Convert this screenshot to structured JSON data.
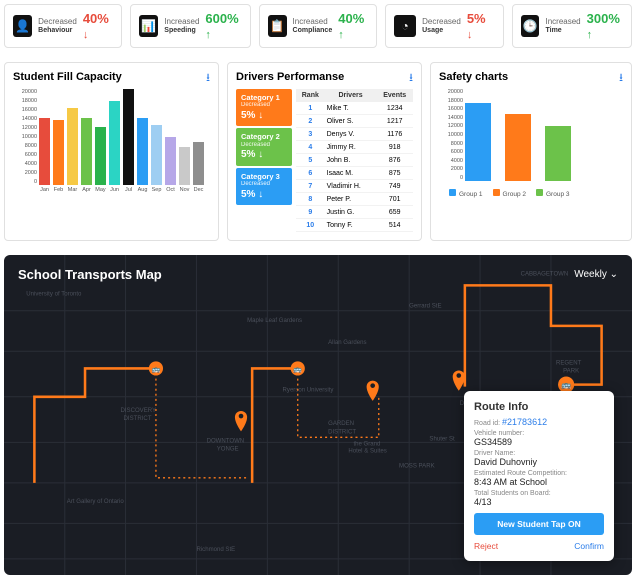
{
  "kpis": [
    {
      "icon": "user",
      "label": "Behaviour",
      "trend": "Decreased",
      "value": "40%",
      "dir": "down"
    },
    {
      "icon": "gauge",
      "label": "Speeding",
      "trend": "Increased",
      "value": "600%",
      "dir": "up"
    },
    {
      "icon": "list",
      "label": "Compliance",
      "trend": "Increased",
      "value": "40%",
      "dir": "up"
    },
    {
      "icon": "pie",
      "label": "Usage",
      "trend": "Decreased",
      "value": "5%",
      "dir": "down"
    },
    {
      "icon": "clock",
      "label": "Time",
      "trend": "Increased",
      "value": "300%",
      "dir": "up"
    }
  ],
  "fill": {
    "title": "Student Fill Capacity",
    "y_ticks": [
      "20000",
      "18000",
      "16000",
      "14000",
      "12000",
      "10000",
      "8000",
      "6000",
      "4000",
      "2000",
      "0"
    ]
  },
  "drivers": {
    "title": "Drivers Performanse",
    "categories": [
      {
        "name": "Category 1",
        "trend": "Decreased",
        "value": "5%",
        "color": "#ff7a1a"
      },
      {
        "name": "Category 2",
        "trend": "Decreased",
        "value": "5%",
        "color": "#6cc24a"
      },
      {
        "name": "Category 3",
        "trend": "Decreased",
        "value": "5%",
        "color": "#2b9df4"
      }
    ],
    "headers": [
      "Rank",
      "Drivers",
      "Events"
    ],
    "rows": [
      [
        "1",
        "Mike T.",
        "1234"
      ],
      [
        "2",
        "Oliver S.",
        "1217"
      ],
      [
        "3",
        "Denys V.",
        "1176"
      ],
      [
        "4",
        "Jimmy R.",
        "918"
      ],
      [
        "5",
        "John B.",
        "876"
      ],
      [
        "6",
        "Isaac M.",
        "875"
      ],
      [
        "7",
        "Vladimir H.",
        "749"
      ],
      [
        "8",
        "Peter P.",
        "701"
      ],
      [
        "9",
        "Justin G.",
        "659"
      ],
      [
        "10",
        "Tonny F.",
        "514"
      ]
    ]
  },
  "safety": {
    "title": "Safety charts",
    "y_ticks": [
      "20000",
      "18000",
      "16000",
      "14000",
      "12000",
      "10000",
      "8000",
      "6000",
      "4000",
      "2000",
      "0"
    ],
    "legend": [
      "Group 1",
      "Group 2",
      "Group 3"
    ]
  },
  "map": {
    "title": "School Transports Map",
    "period": "Weekly",
    "roads": [
      "CABBAGETOWN",
      "Gerrard StE",
      "Maple Leaf Gardens",
      "Allan Gardens",
      "Ryerson University",
      "GARDEN DISTRICT",
      "Dundas StE",
      "DISCOVERY DISTRICT",
      "REGENT PARK",
      "MOSS PARK",
      "Art Gallery of Ontario",
      "DOWNTOWN YONGE",
      "Richmond StE",
      "the Grand Hotel & Suites",
      "University of Toronto",
      "Shuter St"
    ],
    "route_info": {
      "title": "Route Info",
      "road_label": "Road id:",
      "road_id": "#21783612",
      "vehicle_label": "Vehicle number:",
      "vehicle": "GS34589",
      "driver_label": "Driver Name:",
      "driver": "David Duhovniy",
      "eta_label": "Estimated Route Competition:",
      "eta": "8:43 AM at School",
      "students_label": "Total Students on Board:",
      "students": "4/13",
      "tap_btn": "New Student Tap ON",
      "reject": "Reject",
      "confirm": "Confirm"
    }
  },
  "chart_data": [
    {
      "type": "bar",
      "title": "Student Fill Capacity",
      "categories": [
        "Jan",
        "Feb",
        "Mar",
        "Apr",
        "May",
        "Jun",
        "Jul",
        "Aug",
        "Sep",
        "Oct",
        "Nov",
        "Dec"
      ],
      "values": [
        14000,
        13500,
        16000,
        14000,
        12000,
        17500,
        20000,
        14000,
        12500,
        10000,
        8000,
        9000
      ],
      "colors": [
        "#e74c3c",
        "#ff7a1a",
        "#f6c945",
        "#6cc24a",
        "#2bb24c",
        "#2bd4c4",
        "#111111",
        "#2b9df4",
        "#9ecef2",
        "#b6a7e8",
        "#c9c9c9",
        "#8e8e8e"
      ],
      "ylim": [
        0,
        20000
      ],
      "ylabel": "",
      "xlabel": ""
    },
    {
      "type": "bar",
      "title": "Safety charts",
      "categories": [
        "Group 1",
        "Group 2",
        "Group 3"
      ],
      "values": [
        17000,
        14500,
        12000
      ],
      "colors": [
        "#2b9df4",
        "#ff7a1a",
        "#6cc24a"
      ],
      "ylim": [
        0,
        20000
      ],
      "ylabel": "",
      "xlabel": ""
    }
  ]
}
